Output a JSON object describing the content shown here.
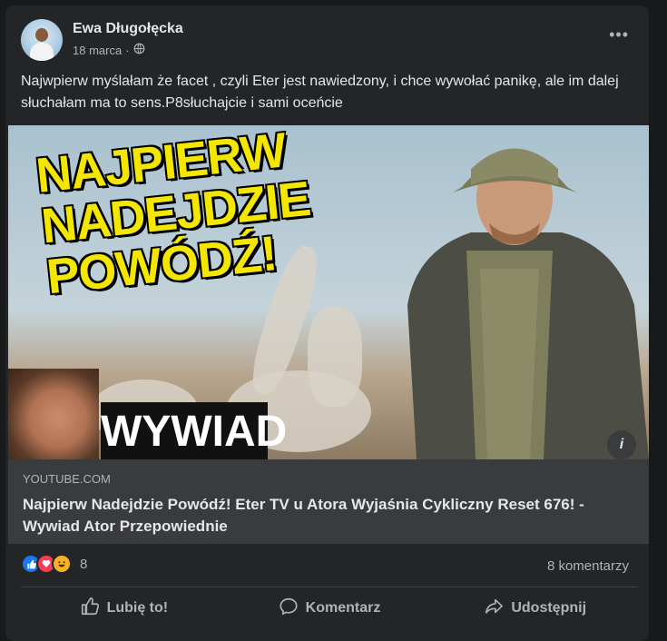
{
  "post": {
    "author": "Ewa Długołęcka",
    "date": "18 marca",
    "separator": "·",
    "audience_icon": "globe-icon",
    "more_label": "•••",
    "text": "Najwpierw myślałam że facet , czyli Eter jest nawiedzony, i chce wywołać panikę, ale im dalej słuchałam ma to sens.P8słuchajcie i sami oceńcie"
  },
  "media": {
    "headline": "NAJPIERW NADEJDZIE POWÓDŹ!",
    "badge": "WYWIAD",
    "info_label": "i"
  },
  "link": {
    "domain": "YOUTUBE.COM",
    "title": "Najpierw Nadejdzie Powódź! Eter TV u Atora Wyjaśnia Cykliczny Reset 676! - Wywiad Ator Przepowiednie"
  },
  "stats": {
    "reaction_count": "8",
    "comments": "8 komentarzy"
  },
  "actions": {
    "like": "Lubię to!",
    "comment": "Komentarz",
    "share": "Udostępnij"
  },
  "colors": {
    "background": "#18191a",
    "card": "#242526",
    "text_primary": "#e4e6eb",
    "text_secondary": "#b0b3b8",
    "headline_yellow": "#f3e600",
    "like_blue": "#1877f2",
    "love_red": "#f33e58",
    "haha_yellow": "#f7b125"
  }
}
